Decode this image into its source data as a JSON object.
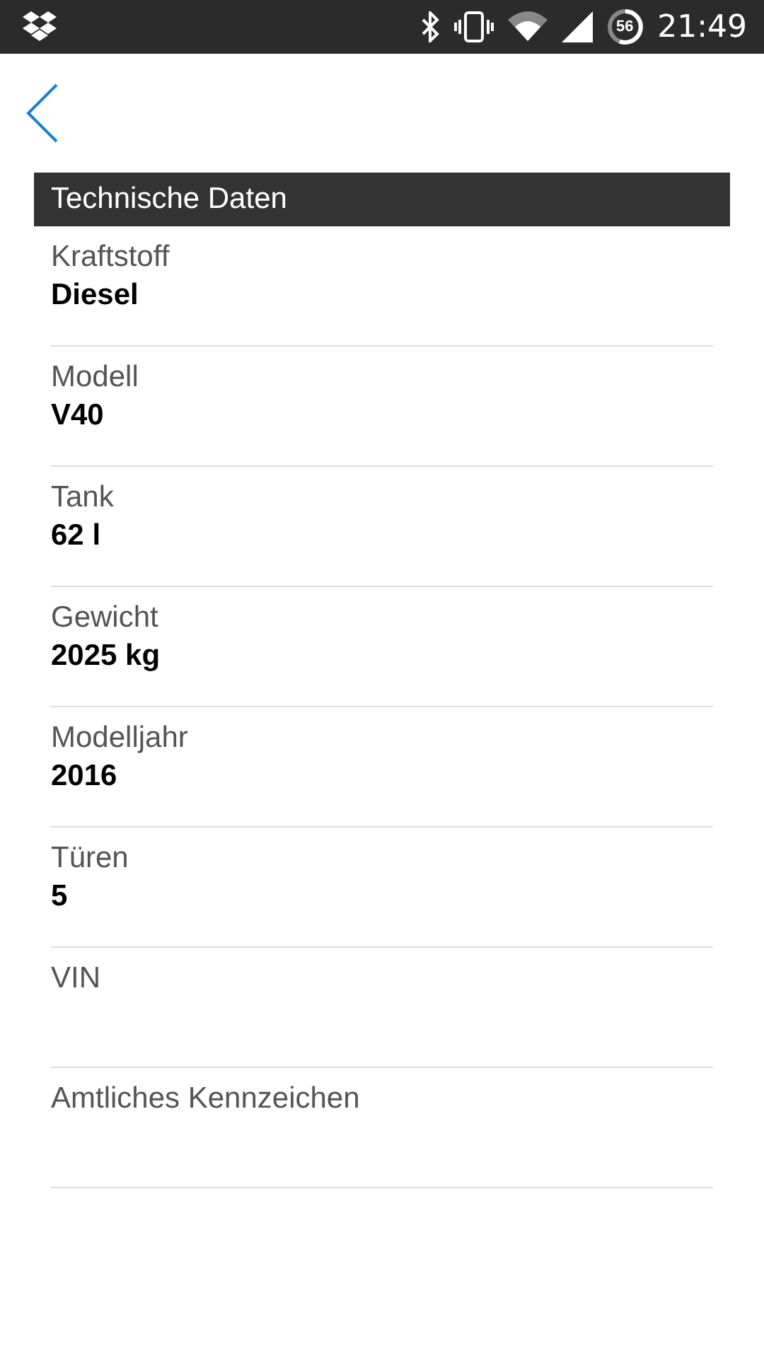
{
  "status_bar": {
    "battery_text": "56",
    "time": "21:49"
  },
  "section": {
    "title": "Technische Daten"
  },
  "fields": [
    {
      "label": "Kraftstoff",
      "value": "Diesel"
    },
    {
      "label": "Modell",
      "value": "V40"
    },
    {
      "label": "Tank",
      "value": "62 l"
    },
    {
      "label": "Gewicht",
      "value": "2025 kg"
    },
    {
      "label": "Modelljahr",
      "value": "2016"
    },
    {
      "label": "Türen",
      "value": "5"
    },
    {
      "label": "VIN"
    },
    {
      "label": "Amtliches Kennzeichen"
    }
  ]
}
